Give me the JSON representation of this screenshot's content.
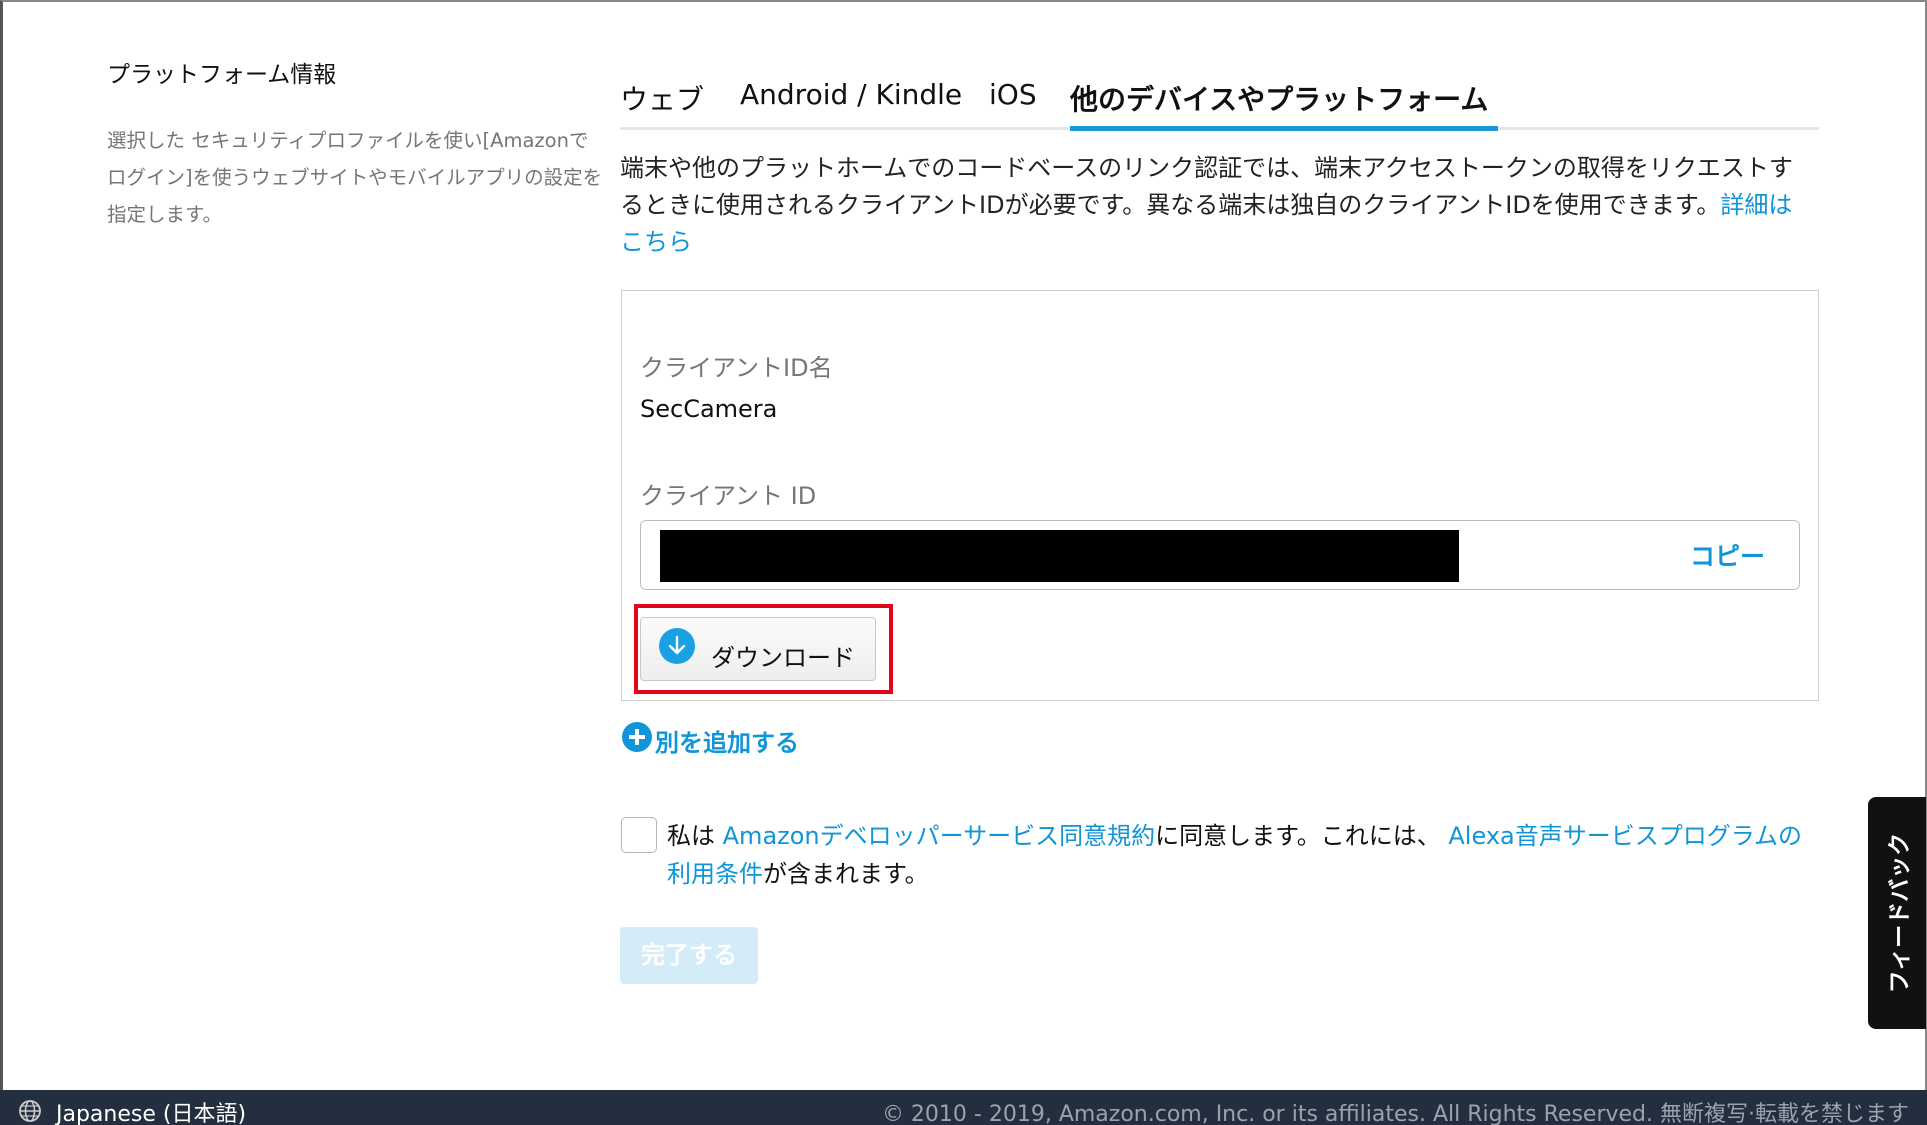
{
  "sidebar": {
    "title": "プラットフォーム情報",
    "description": "選択した セキュリティプロファイルを使い[Amazonでログイン]を使うウェブサイトやモバイルアプリの設定を指定します。"
  },
  "tabs": [
    {
      "label": "ウェブ",
      "active": false
    },
    {
      "label": "Android / Kindle",
      "active": false
    },
    {
      "label": "iOS",
      "active": false
    },
    {
      "label": "他のデバイスやプラットフォーム",
      "active": true
    }
  ],
  "intro": {
    "text": "端末や他のプラットホームでのコードベースのリンク認証では、端末アクセストークンの取得をリクエストするときに使用されるクライアントIDが必要です。異なる端末は独自のクライアントIDを使用できます。",
    "link": "詳細はこちら"
  },
  "client": {
    "name_label": "クライアントID名",
    "name_value": "SecCamera",
    "id_label": "クライアント ID",
    "copy_label": "コピー",
    "download_label": "ダウンロード"
  },
  "add_another": "別を追加する",
  "agreement": {
    "prefix": "私は ",
    "link1": "Amazonデベロッパーサービス同意規約",
    "middle": "に同意します。これには、 ",
    "link2": "Alexa音声サービスプログラムの利用条件",
    "suffix": "が含まれます。"
  },
  "finish_label": "完了する",
  "feedback_label": "フィードバック",
  "footer": {
    "language": "Japanese (日本語)",
    "copyright": "© 2010 - 2019, Amazon.com, Inc. or its affiliates. All Rights Reserved. 無断複写·転載を禁じます"
  },
  "colors": {
    "accent": "#0f95d8",
    "tab_underline": "#1a98d5",
    "highlight": "#e1061b",
    "footer_bg": "#232f3e",
    "disabled_button": "#d3ecf7"
  },
  "icons": [
    "download-icon",
    "plus-circle-icon",
    "globe-icon"
  ]
}
